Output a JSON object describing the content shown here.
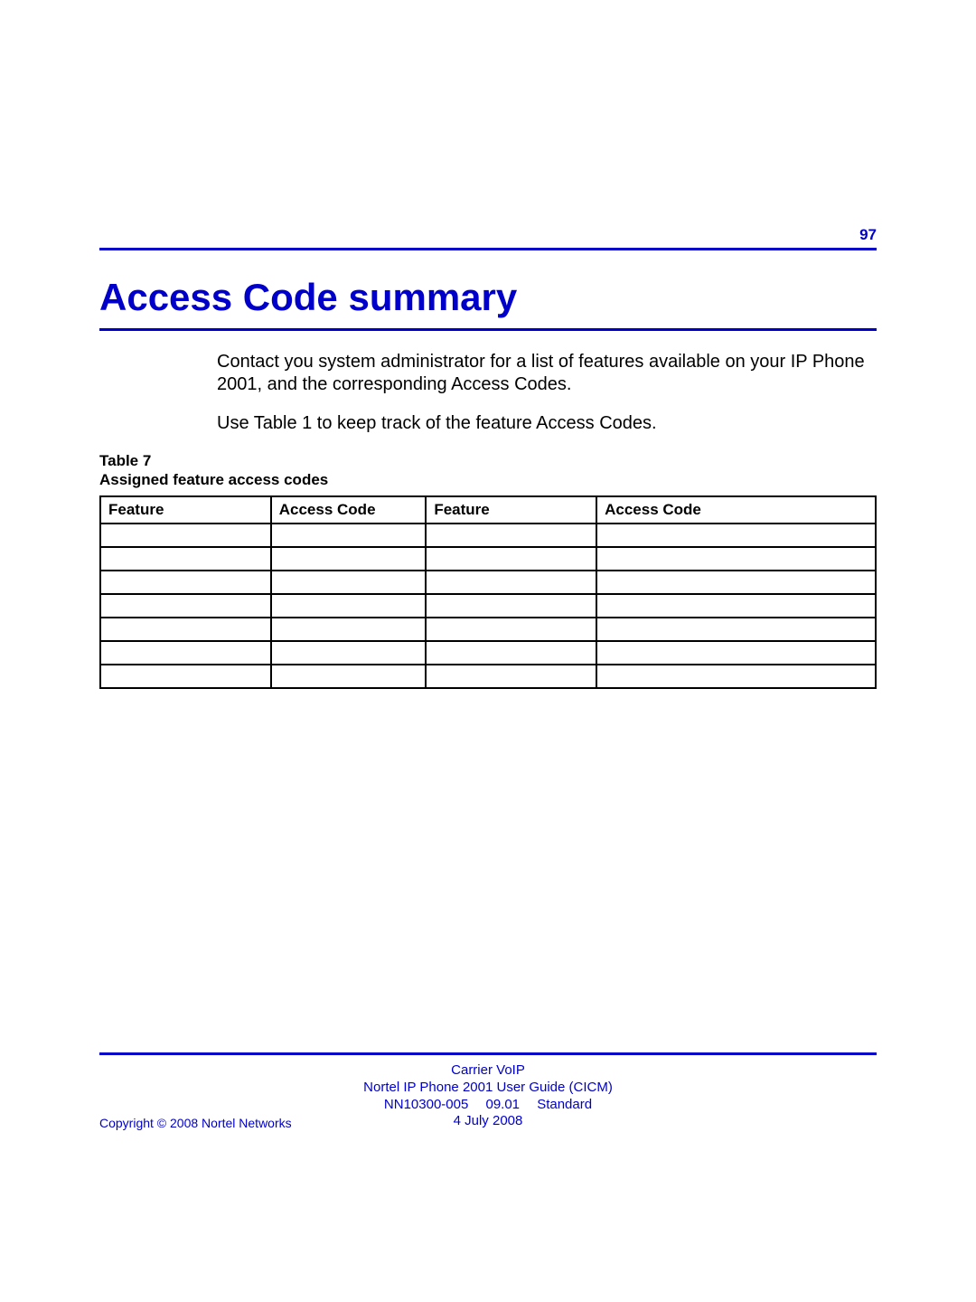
{
  "pageNumber": "97",
  "heading": "Access Code summary",
  "paragraphs": {
    "p1": "Contact you system administrator for a list of features available on your IP Phone 2001, and the corresponding Access Codes.",
    "p2": "Use Table 1 to keep track of the feature Access Codes."
  },
  "tableCaption": {
    "line1": "Table 7",
    "line2": "Assigned feature access codes"
  },
  "tableHeaders": {
    "h1": "Feature",
    "h2": "Access Code",
    "h3": "Feature",
    "h4": "Access Code"
  },
  "footer": {
    "line1": "Carrier VoIP",
    "line2": "Nortel IP Phone 2001 User Guide (CICM)",
    "line3": "NN10300-005  09.01  Standard",
    "line4": "4 July 2008",
    "copyright": "Copyright © 2008 Nortel Networks"
  }
}
